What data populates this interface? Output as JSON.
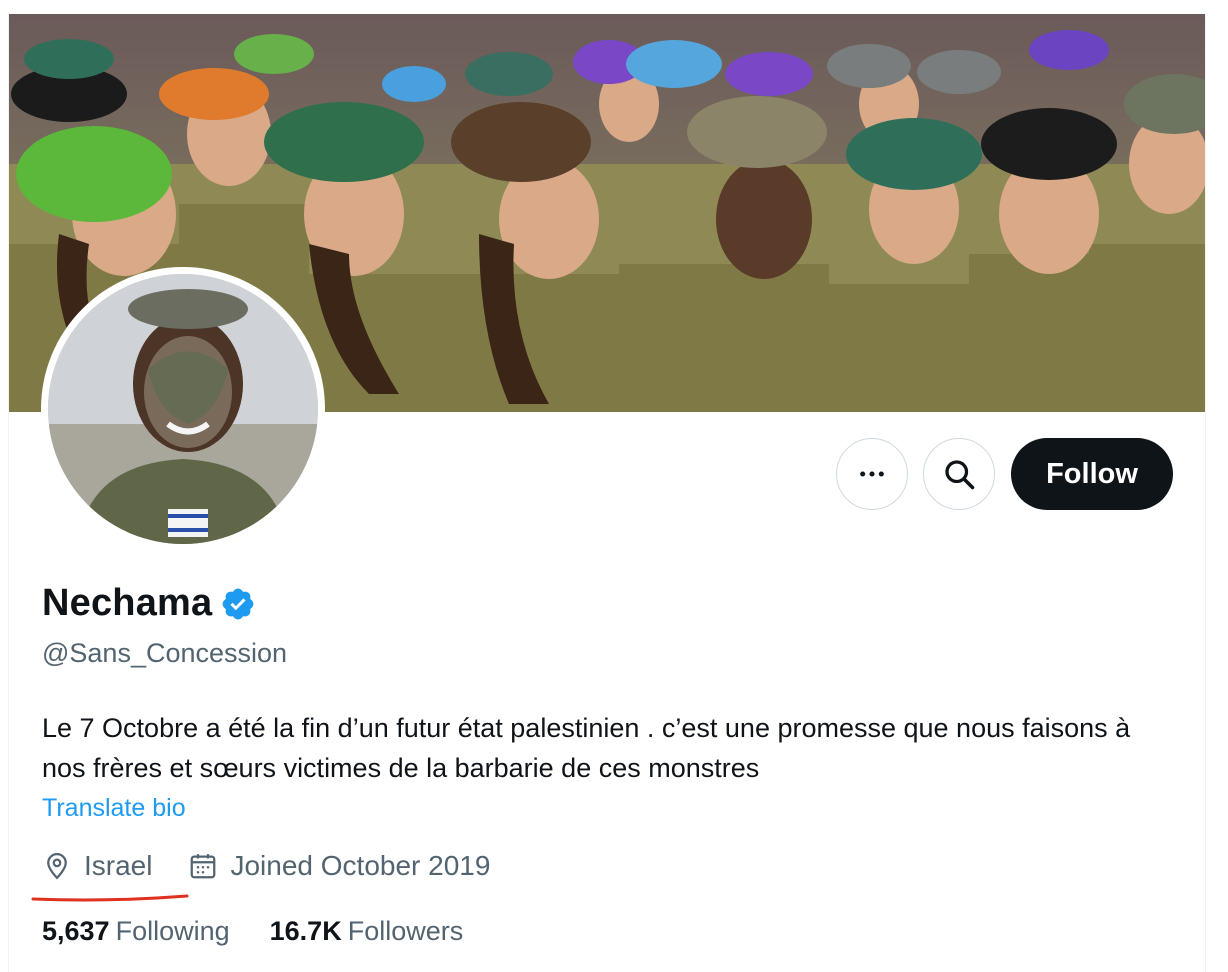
{
  "profile": {
    "display_name": "Nechama",
    "handle": "@Sans_Concession",
    "bio": "Le 7 Octobre a été la fin d’un futur état palestinien . c’est une promesse que nous faisons à nos frères et sœurs victimes de la barbarie de ces monstres",
    "translate_label": "Translate bio",
    "location": "Israel",
    "joined": "Joined October 2019",
    "following_count": "5,637",
    "following_label": "Following",
    "followers_count": "16.7K",
    "followers_label": "Followers",
    "verified": true
  },
  "actions": {
    "more_icon": "more-horizontal-icon",
    "search_icon": "search-icon",
    "follow_label": "Follow"
  },
  "colors": {
    "accent_blue": "#1d9bf0",
    "text_primary": "#0f1419",
    "text_secondary": "#536471",
    "follow_bg": "#0f1419",
    "annotation_red": "#e0301e"
  }
}
